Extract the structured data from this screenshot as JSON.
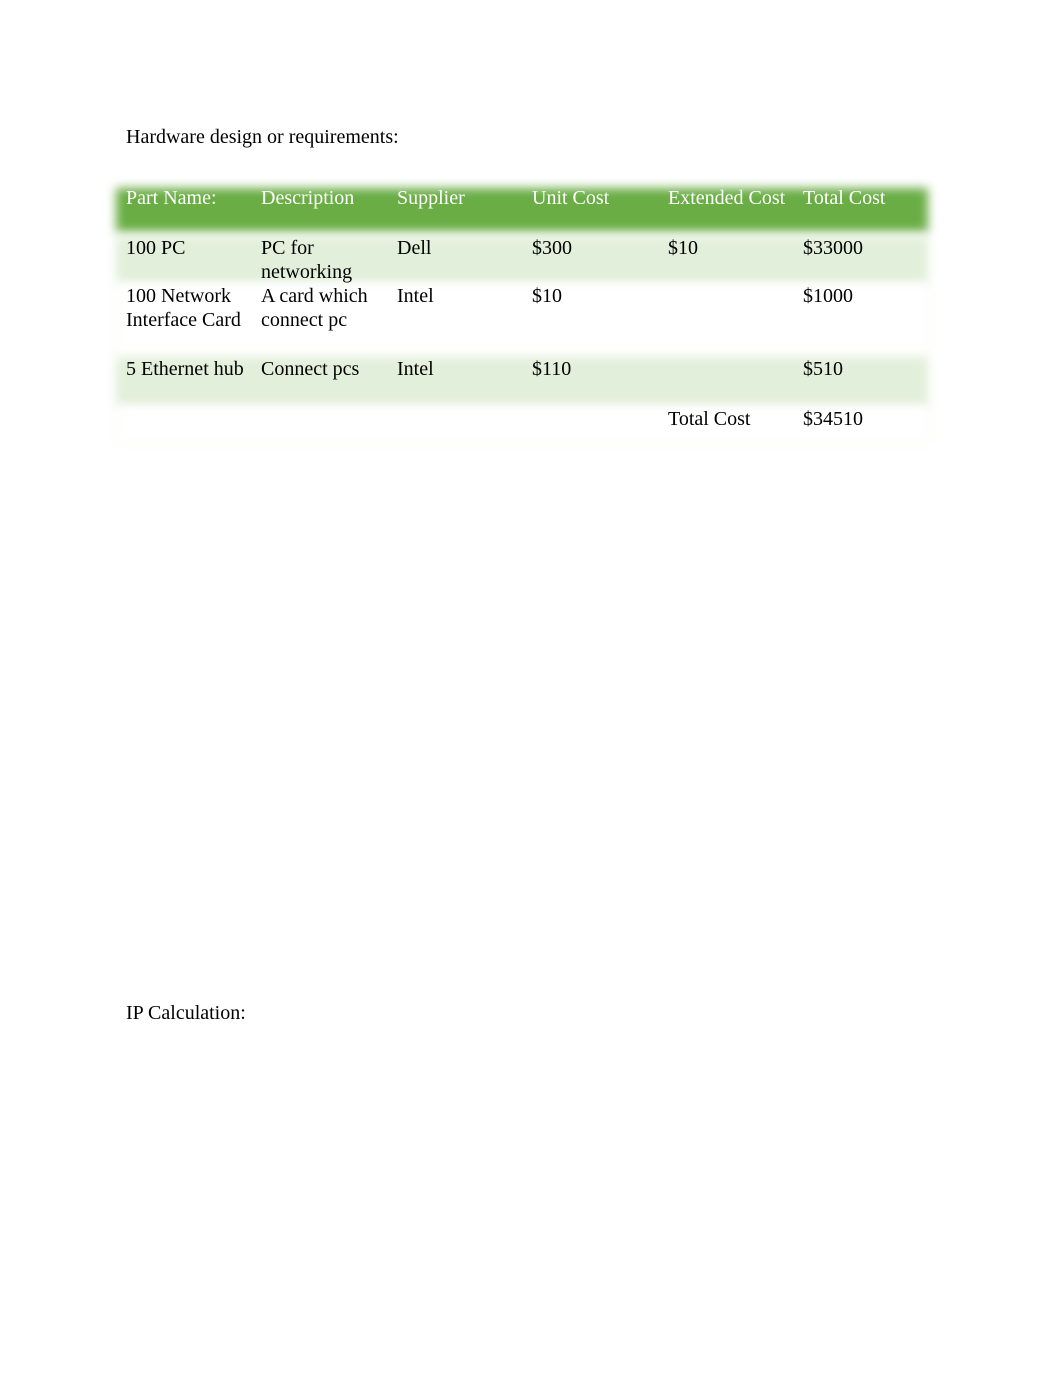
{
  "document": {
    "heading_hardware": "Hardware design or requirements:",
    "heading_ip": "IP Calculation:"
  },
  "table": {
    "headers": [
      "Part Name:",
      "Description",
      "Supplier",
      "Unit Cost",
      "Extended Cost",
      "Total Cost"
    ],
    "rows": [
      [
        "100 PC",
        "PC for networking",
        "Dell",
        "$300",
        "$10",
        "$33000"
      ],
      [
        "100 Network Interface Card",
        "A card which connect pc",
        "Intel",
        "$10",
        "",
        "$1000"
      ],
      [
        "5 Ethernet hub",
        "Connect pcs",
        "Intel",
        "$110",
        "",
        "$510"
      ],
      [
        "",
        "",
        "",
        "",
        "Total Cost",
        "$34510"
      ]
    ]
  },
  "colors": {
    "header_bg": "#6aad45",
    "band_bg": "#e2efda",
    "header_text": "#ffffff"
  }
}
